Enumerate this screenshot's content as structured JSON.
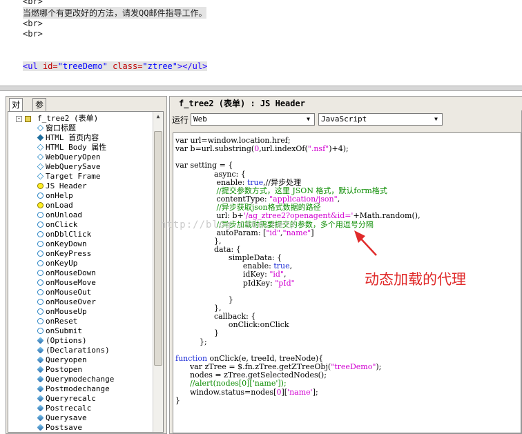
{
  "top_source": {
    "line1": "<br>",
    "line2": "当燃哪个有更改好的方法，请发QQ邮件指导工作。",
    "line3": "<br>",
    "line4": "<br>",
    "ul_tag_open": "<ul ",
    "ul_attr_id": "id=",
    "ul_val_id": "\"treeDemo\"",
    "ul_attr_class": " class=",
    "ul_val_class": "\"ztree\"",
    "ul_tag_close": "></ul>"
  },
  "left_panel": {
    "tabs": [
      "对象",
      "参考"
    ],
    "expander": "-",
    "root_label": "f_tree2 (表单)",
    "items": [
      {
        "label": "窗口标题",
        "icon": "diamond"
      },
      {
        "label": "HTML 首页内容",
        "icon": "diamond-solid"
      },
      {
        "label": "HTML Body 属性",
        "icon": "diamond"
      },
      {
        "label": "WebQueryOpen",
        "icon": "diamond"
      },
      {
        "label": "WebQuerySave",
        "icon": "diamond"
      },
      {
        "label": "Target Frame",
        "icon": "diamond"
      },
      {
        "label": "JS Header",
        "icon": "circle-y"
      },
      {
        "label": "onHelp",
        "icon": "circle"
      },
      {
        "label": "onLoad",
        "icon": "circle-y"
      },
      {
        "label": "onUnload",
        "icon": "circle"
      },
      {
        "label": "onClick",
        "icon": "circle"
      },
      {
        "label": "onDblClick",
        "icon": "circle"
      },
      {
        "label": "onKeyDown",
        "icon": "circle"
      },
      {
        "label": "onKeyPress",
        "icon": "circle"
      },
      {
        "label": "onKeyUp",
        "icon": "circle"
      },
      {
        "label": "onMouseDown",
        "icon": "circle"
      },
      {
        "label": "onMouseMove",
        "icon": "circle"
      },
      {
        "label": "onMouseOut",
        "icon": "circle"
      },
      {
        "label": "onMouseOver",
        "icon": "circle"
      },
      {
        "label": "onMouseUp",
        "icon": "circle"
      },
      {
        "label": "onReset",
        "icon": "circle"
      },
      {
        "label": "onSubmit",
        "icon": "circle"
      },
      {
        "label": "(Options)",
        "icon": "gem"
      },
      {
        "label": "(Declarations)",
        "icon": "gem"
      },
      {
        "label": "Queryopen",
        "icon": "gem"
      },
      {
        "label": "Postopen",
        "icon": "gem"
      },
      {
        "label": "Querymodechange",
        "icon": "gem"
      },
      {
        "label": "Postmodechange",
        "icon": "gem"
      },
      {
        "label": "Queryrecalc",
        "icon": "gem"
      },
      {
        "label": "Postrecalc",
        "icon": "gem"
      },
      {
        "label": "Querysave",
        "icon": "gem"
      },
      {
        "label": "Postsave",
        "icon": "gem"
      }
    ]
  },
  "right_panel": {
    "title": "f_tree2 (表单) : JS Header",
    "run_label": "运行",
    "run_target": "Web",
    "language": "JavaScript"
  },
  "code_lines": [
    [
      {
        "t": "var url=window.location.href;",
        "c": "k"
      }
    ],
    [
      {
        "t": "var b=url.substring(",
        "c": "k"
      },
      {
        "t": "0",
        "c": "str"
      },
      {
        "t": ",url.indexOf(",
        "c": "k"
      },
      {
        "t": "\".nsf\"",
        "c": "str"
      },
      {
        "t": ")+4);",
        "c": "k"
      }
    ],
    [],
    [
      {
        "t": "var setting = {",
        "c": "k"
      }
    ],
    [
      {
        "t": "                async: {",
        "c": "k"
      }
    ],
    [
      {
        "t": "                 enable: ",
        "c": "k"
      },
      {
        "t": "true",
        "c": "blue"
      },
      {
        "t": ",//异步处理",
        "c": "k"
      }
    ],
    [
      {
        "t": "                 //提交参数方式，这里 JSON 格式，默认form格式",
        "c": "cm"
      }
    ],
    [
      {
        "t": "                 contentType: ",
        "c": "k"
      },
      {
        "t": "\"application/json\"",
        "c": "str"
      },
      {
        "t": ",",
        "c": "k"
      }
    ],
    [
      {
        "t": "                 //异步获取json格式数据的路径",
        "c": "cm"
      }
    ],
    [
      {
        "t": "                 url: b+",
        "c": "k"
      },
      {
        "t": "'/ag_ztree2?openagent&id='",
        "c": "str"
      },
      {
        "t": "+Math.random(),",
        "c": "k"
      }
    ],
    [
      {
        "t": "                 //异步加载时需要提交的参数，多个用逗号分隔",
        "c": "cm"
      }
    ],
    [
      {
        "t": "                 autoParam: [",
        "c": "k"
      },
      {
        "t": "\"id\"",
        "c": "str"
      },
      {
        "t": ",",
        "c": "k"
      },
      {
        "t": "\"name\"",
        "c": "str"
      },
      {
        "t": "]",
        "c": "k"
      }
    ],
    [
      {
        "t": "                },",
        "c": "k"
      }
    ],
    [
      {
        "t": "                data: {",
        "c": "k"
      }
    ],
    [
      {
        "t": "                      simpleData: {",
        "c": "k"
      }
    ],
    [
      {
        "t": "                            enable: ",
        "c": "k"
      },
      {
        "t": "true",
        "c": "blue"
      },
      {
        "t": ",",
        "c": "k"
      }
    ],
    [
      {
        "t": "                            idKey: ",
        "c": "k"
      },
      {
        "t": "\"id\"",
        "c": "str"
      },
      {
        "t": ",",
        "c": "k"
      }
    ],
    [
      {
        "t": "                            pIdKey: ",
        "c": "k"
      },
      {
        "t": "\"pId\"",
        "c": "str"
      }
    ],
    [],
    [
      {
        "t": "                      }",
        "c": "k"
      }
    ],
    [
      {
        "t": "                },",
        "c": "k"
      }
    ],
    [
      {
        "t": "                callback: {",
        "c": "k"
      }
    ],
    [
      {
        "t": "                      onClick:onClick",
        "c": "k"
      }
    ],
    [
      {
        "t": "                }",
        "c": "k"
      }
    ],
    [
      {
        "t": "          };",
        "c": "k"
      }
    ],
    [],
    [
      {
        "t": "function",
        "c": "blue"
      },
      {
        "t": " onClick(e, treeId, treeNode){",
        "c": "k"
      }
    ],
    [
      {
        "t": "      var zTree = $.fn.zTree.getZTreeObj(",
        "c": "k"
      },
      {
        "t": "\"treeDemo\"",
        "c": "str"
      },
      {
        "t": ");",
        "c": "k"
      }
    ],
    [
      {
        "t": "      nodes = zTree.getSelectedNodes();",
        "c": "k"
      }
    ],
    [
      {
        "t": "      //alert(nodes[0]['name']);",
        "c": "cm"
      }
    ],
    [
      {
        "t": "      window.status=nodes[",
        "c": "k"
      },
      {
        "t": "0",
        "c": "str"
      },
      {
        "t": "][",
        "c": "k"
      },
      {
        "t": "'name'",
        "c": "str"
      },
      {
        "t": "];",
        "c": "k"
      }
    ],
    [
      {
        "t": "}",
        "c": "k"
      }
    ]
  ],
  "watermark": "http://blog.csdn.net/",
  "annotation": "动态加载的代理",
  "colors": {
    "annotation": "#e02b2b",
    "comment": "#0b8c00",
    "string": "#d100d1",
    "keyword_blue": "#1c2bd6"
  }
}
